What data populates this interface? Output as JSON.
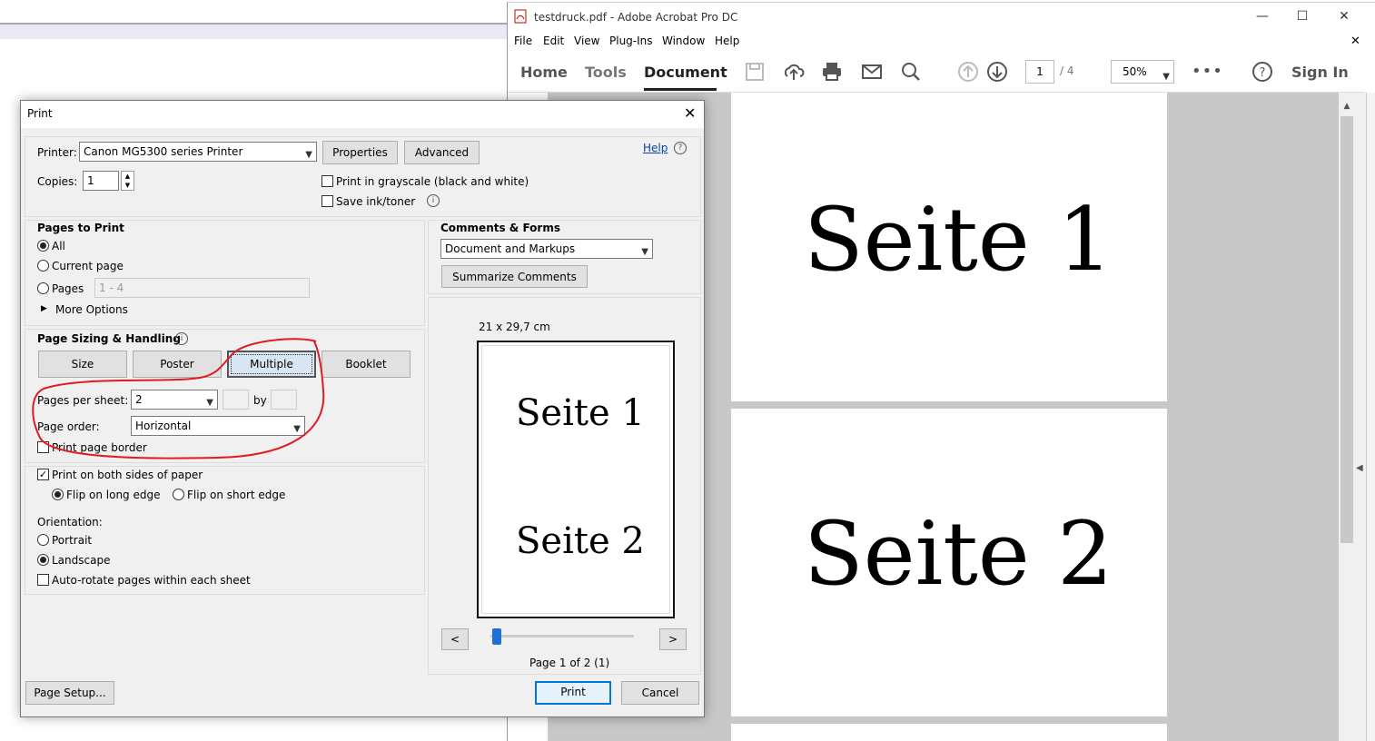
{
  "acrobat": {
    "title": "testdruck.pdf - Adobe Acrobat Pro DC",
    "menu": [
      "File",
      "Edit",
      "View",
      "Plug-Ins",
      "Window",
      "Help"
    ],
    "tabs": {
      "home": "Home",
      "tools": "Tools",
      "document": "Document"
    },
    "page_current": "1",
    "page_total": "/ 4",
    "zoom": "50%",
    "sign_in": "Sign In",
    "page1_text": "Seite 1",
    "page2_text": "Seite 2"
  },
  "dialog": {
    "title": "Print",
    "printer_label": "Printer:",
    "printer_value": "Canon MG5300 series Printer",
    "properties": "Properties",
    "advanced": "Advanced",
    "help": "Help",
    "copies_label": "Copies:",
    "copies_value": "1",
    "grayscale": "Print in grayscale (black and white)",
    "save_ink": "Save ink/toner",
    "pages_to_print": {
      "heading": "Pages to Print",
      "all": "All",
      "current": "Current page",
      "pages": "Pages",
      "pages_value": "1 - 4",
      "more": "More Options"
    },
    "sizing": {
      "heading": "Page Sizing & Handling",
      "size": "Size",
      "poster": "Poster",
      "multiple": "Multiple",
      "booklet": "Booklet",
      "pps_label": "Pages per sheet:",
      "pps_value": "2",
      "by": "by",
      "order_label": "Page order:",
      "order_value": "Horizontal",
      "border": "Print page border"
    },
    "duplex": {
      "both_sides": "Print on both sides of paper",
      "long_edge": "Flip on long edge",
      "short_edge": "Flip on short edge",
      "orientation": "Orientation:",
      "portrait": "Portrait",
      "landscape": "Landscape",
      "auto_rotate": "Auto-rotate pages within each sheet"
    },
    "comments": {
      "heading": "Comments & Forms",
      "value": "Document and Markups",
      "summarize": "Summarize Comments"
    },
    "preview": {
      "size": "21 x 29,7 cm",
      "seite1": "Seite 1",
      "seite2": "Seite 2",
      "prev": "<",
      "next": ">",
      "page_info": "Page 1 of 2 (1)",
      "position": 0
    },
    "page_setup": "Page Setup...",
    "print": "Print",
    "cancel": "Cancel"
  }
}
